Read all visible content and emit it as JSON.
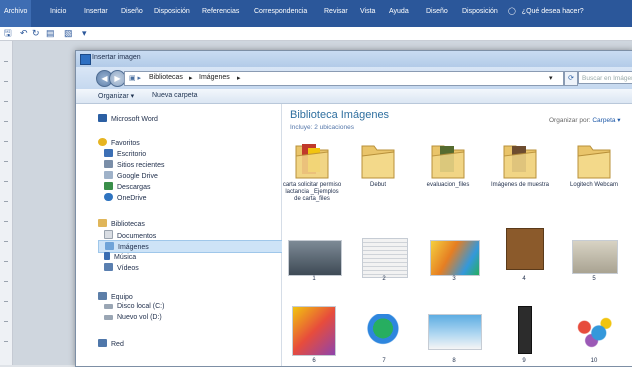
{
  "ribbon": {
    "tabs": [
      "Archivo",
      "Inicio",
      "Insertar",
      "Diseño",
      "Disposición",
      "Referencias",
      "Correspondencia",
      "Revisar",
      "Vista",
      "Ayuda",
      "Diseño",
      "Disposición"
    ],
    "help": "¿Qué desea hacer?",
    "color": "#2b579a"
  },
  "dialog": {
    "title": "Insertar imagen",
    "breadcrumb": [
      "Bibliotecas",
      "Imágenes"
    ],
    "search_placeholder": "Buscar en Imágenes",
    "commands": {
      "organize": "Organizar ▾",
      "new_folder": "Nueva carpeta"
    },
    "nav": [
      {
        "label": "Microsoft Word",
        "icon": "word-icon",
        "color": "#2b5fa3"
      },
      {
        "label": "Favoritos",
        "icon": "star-icon",
        "color": "#e6b422"
      },
      {
        "label": "Escritorio",
        "icon": "desktop-icon",
        "color": "#3c6fb5"
      },
      {
        "label": "Sitios recientes",
        "icon": "recent-icon",
        "color": "#7a8ea8"
      },
      {
        "label": "Google Drive",
        "icon": "drive-icon",
        "color": "#9fb2c9"
      },
      {
        "label": "Descargas",
        "icon": "download-icon",
        "color": "#3a8f4a"
      },
      {
        "label": "OneDrive",
        "icon": "cloud-icon",
        "color": "#2f74c0"
      },
      {
        "label": "Bibliotecas",
        "icon": "library-icon",
        "color": "#e0b65a"
      },
      {
        "label": "Documentos",
        "icon": "documents-icon",
        "color": "#d9dde3"
      },
      {
        "label": "Imágenes",
        "icon": "pictures-icon",
        "color": "#6fa3d8"
      },
      {
        "label": "Música",
        "icon": "music-icon",
        "color": "#3a6db2"
      },
      {
        "label": "Vídeos",
        "icon": "video-icon",
        "color": "#5a7fb0"
      },
      {
        "label": "Equipo",
        "icon": "computer-icon",
        "color": "#5c7ea8"
      },
      {
        "label": "Disco local (C:)",
        "icon": "drive-c-icon",
        "color": "#9aa6b4"
      },
      {
        "label": "Nuevo vol (D:)",
        "icon": "drive-d-icon",
        "color": "#9aa6b4"
      },
      {
        "label": "Red",
        "icon": "network-icon",
        "color": "#4f77aa"
      }
    ],
    "library": {
      "title": "Biblioteca Imágenes",
      "subtitle": "Incluye: 2 ubicaciones",
      "arrange_label": "Organizar por:",
      "arrange_value": "Carpeta ▾"
    },
    "folders": [
      "carta solicitar permiso lactancia _Ejemplos de carta_files",
      "Debut",
      "evaluacion_files",
      "Imágenes de muestra",
      "Logitech Webcam"
    ],
    "images": [
      "1",
      "2",
      "3",
      "4",
      "5",
      "6",
      "7",
      "8",
      "9",
      "10"
    ]
  }
}
